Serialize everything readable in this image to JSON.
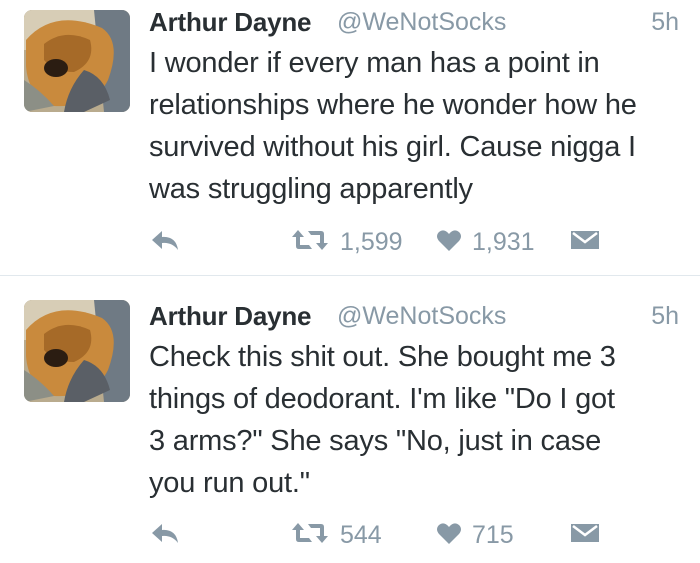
{
  "tweets": [
    {
      "name": "Arthur Dayne",
      "handle": "@WeNotSocks",
      "time": "5h",
      "text": "I wonder if every man has a point in\nrelationships where he wonder how he\nsurvived without his girl. Cause nigga I\nwas struggling apparently",
      "retweets": "1,599",
      "likes": "1,931"
    },
    {
      "name": "Arthur Dayne",
      "handle": "@WeNotSocks",
      "time": "5h",
      "text": "Check this shit out. She bought me 3\nthings of deodorant. I'm like \"Do I got\n3 arms?\" She says \"No, just in case\nyou run out.\"",
      "retweets": "544",
      "likes": "715"
    }
  ],
  "icons": {
    "reply": "reply-icon",
    "retweet": "retweet-icon",
    "like": "heart-icon",
    "dm": "direct-message-icon"
  },
  "colors": {
    "text": "#292f33",
    "muted": "#8899a6",
    "divider": "#e1e8ed"
  }
}
